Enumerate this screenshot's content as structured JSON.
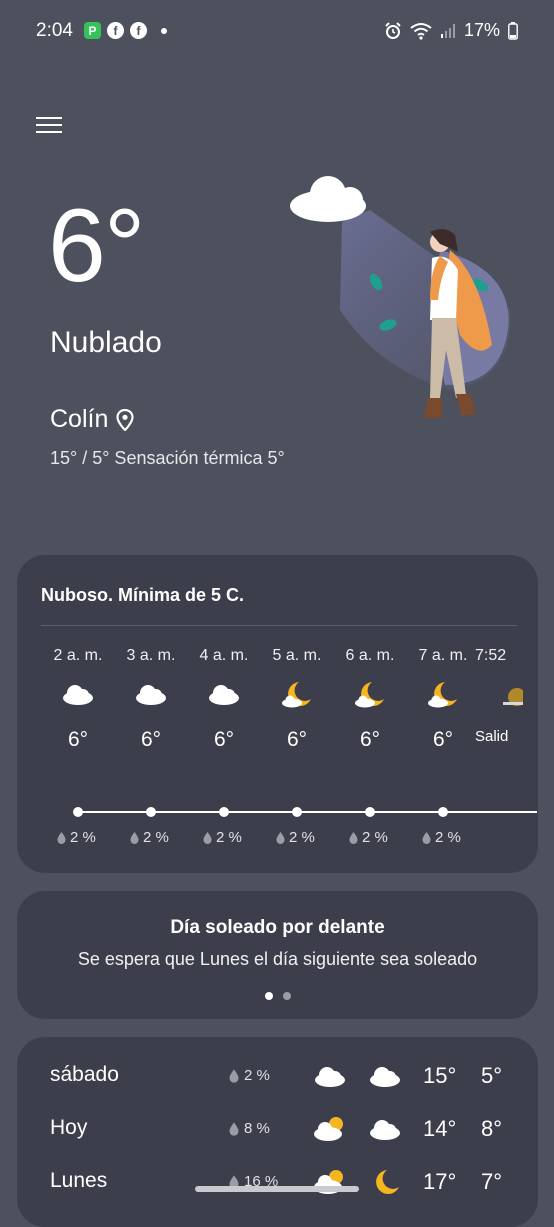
{
  "status_bar": {
    "time": "2:04",
    "battery": "17%",
    "icons_left": [
      "pago-app-icon",
      "facebook-icon",
      "facebook-icon",
      "notification-dot"
    ],
    "icons_right": [
      "alarm-icon",
      "wifi-icon",
      "signal-icon",
      "battery-icon"
    ]
  },
  "current": {
    "temperature": "6°",
    "condition": "Nublado",
    "location": "Colín",
    "minmax": "15° / 5° Sensación térmica 5°"
  },
  "hourly": {
    "summary": "Nuboso. Mínima de 5 C.",
    "hours": [
      {
        "time": "2 a. m.",
        "icon": "cloud-icon",
        "temp": "6°",
        "precip": "2 %"
      },
      {
        "time": "3 a. m.",
        "icon": "cloud-icon",
        "temp": "6°",
        "precip": "2 %"
      },
      {
        "time": "4 a. m.",
        "icon": "cloud-icon",
        "temp": "6°",
        "precip": "2 %"
      },
      {
        "time": "5 a. m.",
        "icon": "moon-cloud-icon",
        "temp": "6°",
        "precip": "2 %"
      },
      {
        "time": "6 a. m.",
        "icon": "moon-cloud-icon",
        "temp": "6°",
        "precip": "2 %"
      },
      {
        "time": "7 a. m.",
        "icon": "moon-cloud-icon",
        "temp": "6°",
        "precip": "2 %"
      },
      {
        "time": "7:52",
        "icon": "sunrise-icon",
        "sunrise_label": "Salid"
      }
    ]
  },
  "forecast_card": {
    "title": "Día soleado por delante",
    "subtitle": "Se espera que Lunes el día siguiente sea soleado",
    "pages": 2,
    "active_page": 1
  },
  "daily": [
    {
      "day": "sábado",
      "precip": "2 %",
      "icon_day": "cloud-icon",
      "icon_night": "cloud-icon",
      "high": "15°",
      "low": "5°"
    },
    {
      "day": "Hoy",
      "precip": "8 %",
      "icon_day": "sun-cloud-icon",
      "icon_night": "cloud-icon",
      "high": "14°",
      "low": "8°"
    },
    {
      "day": "Lunes",
      "precip": "16 %",
      "icon_day": "sun-cloud-icon",
      "icon_night": "moon-icon",
      "high": "17°",
      "low": "7°"
    }
  ],
  "colors": {
    "background": "#4d505d",
    "card": "#3c3f4b",
    "moon": "#f5b51f",
    "accent_orange": "#ef9a4a"
  }
}
